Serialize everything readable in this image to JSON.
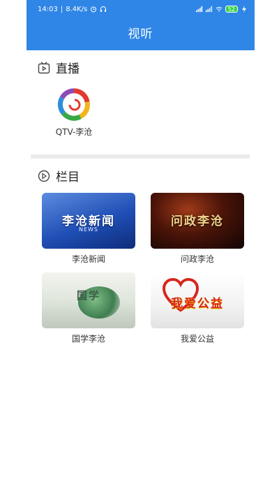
{
  "status_bar": {
    "time": "14:03",
    "net_speed": "8.4K/s",
    "battery": "52"
  },
  "header": {
    "title": "视听"
  },
  "live": {
    "section_label": "直播",
    "items": [
      {
        "label": "QTV-李沧"
      }
    ]
  },
  "programs": {
    "section_label": "栏目",
    "items": [
      {
        "label": "李沧新闻",
        "thumb_title": "李沧新闻",
        "thumb_sub": "NEWS"
      },
      {
        "label": "问政李沧",
        "thumb_title": "问政李沧"
      },
      {
        "label": "国学李沧",
        "thumb_title": "国学"
      },
      {
        "label": "我爱公益",
        "thumb_title": "我爱公益"
      }
    ]
  },
  "colors": {
    "header_blue": "#2f86e6",
    "divider": "#ebebeb"
  }
}
